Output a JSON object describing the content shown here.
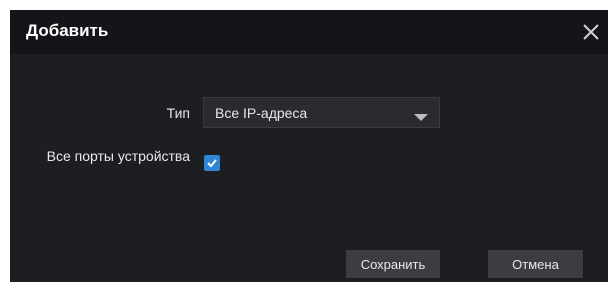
{
  "dialog": {
    "title": "Добавить",
    "close_icon": "close-icon"
  },
  "form": {
    "type_label": "Тип",
    "type_value": "Все IP-адреса",
    "type_dropdown_icon": "chevron-down-icon",
    "all_ports_label": "Все порты устройства",
    "all_ports_checked": true
  },
  "buttons": {
    "save_label": "Сохранить",
    "cancel_label": "Отмена"
  },
  "colors": {
    "background": "#1d1e22",
    "titlebar": "#141518",
    "accent": "#2d87d6",
    "button": "#3c3d42"
  }
}
